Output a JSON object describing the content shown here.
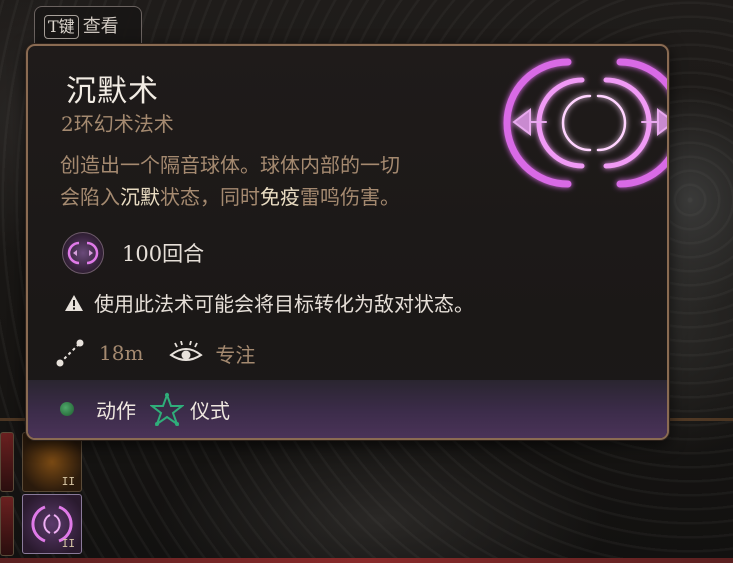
{
  "hotkey": {
    "key": "T键",
    "label": "查看"
  },
  "spell": {
    "name": "沉默术",
    "level_school": "2环幻术法术",
    "description": {
      "part1": "创造出一个隔音球体。球体内部的一切",
      "part2": "会陷入",
      "kw_silence": "沉默",
      "part3": "状态，同时",
      "kw_immune": "免疫",
      "part4": "雷鸣伤害。"
    },
    "duration": "100回合",
    "warning": "使用此法术可能会将目标转化为敌对状态。",
    "range": "18m",
    "concentration": "专注",
    "cost": "动作",
    "ritual": "仪式"
  },
  "icons": {
    "spell_art": "silence-sigil-icon",
    "duration": "turn-hourglass-icon",
    "warning": "warning-triangle-icon",
    "range": "range-icon",
    "concentration": "concentration-eye-icon",
    "action": "action-dot-icon",
    "ritual": "ritual-star-icon"
  },
  "hotbar": {
    "slot_numbers": [
      "II",
      "II"
    ]
  },
  "colors": {
    "accent_purple": "#e070e8",
    "muted_text": "#a58a70",
    "highlight_text": "#e9dcc2",
    "border": "#8a6b52",
    "action_green": "#3f9a5a"
  }
}
